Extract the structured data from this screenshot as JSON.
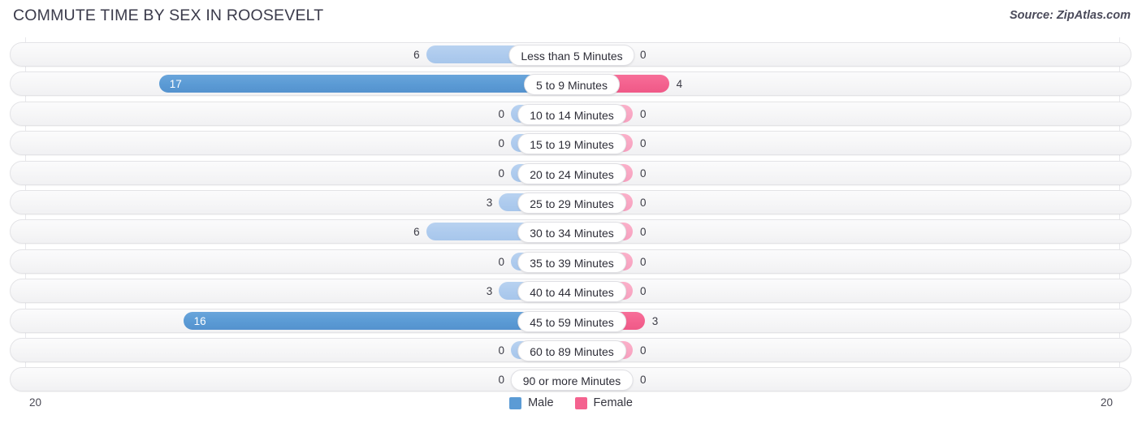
{
  "header": {
    "title": "COMMUTE TIME BY SEX IN ROOSEVELT",
    "source": "Source: ZipAtlas.com"
  },
  "axis": {
    "left_max_label": "20",
    "right_max_label": "20"
  },
  "legend": {
    "items": [
      {
        "label": "Male",
        "color": "#5b9bd5",
        "swatch_icon": "male-legend-swatch"
      },
      {
        "label": "Female",
        "color": "#f4628f",
        "swatch_icon": "female-legend-swatch"
      }
    ]
  },
  "colors": {
    "male": "#5b9bd5",
    "male_dim": "#aecbee",
    "female": "#f4628f",
    "female_dim": "#f9a8c4",
    "row_background": "#f6f6f7",
    "row_border": "#e3e3e6",
    "gridline": "#e8e8ec",
    "title": "#3a3a4a"
  },
  "chart_data": {
    "type": "bar",
    "subtype": "diverging-horizontal-bar",
    "title": "COMMUTE TIME BY SEX IN ROOSEVELT",
    "xlabel": "",
    "ylabel": "",
    "axis_max": 20,
    "xlim": [
      20,
      20
    ],
    "grid": true,
    "legend_position": "bottom-center",
    "categories": [
      "Less than 5 Minutes",
      "5 to 9 Minutes",
      "10 to 14 Minutes",
      "15 to 19 Minutes",
      "20 to 24 Minutes",
      "25 to 29 Minutes",
      "30 to 34 Minutes",
      "35 to 39 Minutes",
      "40 to 44 Minutes",
      "45 to 59 Minutes",
      "60 to 89 Minutes",
      "90 or more Minutes"
    ],
    "series": [
      {
        "name": "Male",
        "direction": "left",
        "values": [
          6,
          17,
          0,
          0,
          0,
          3,
          6,
          0,
          3,
          16,
          0,
          0
        ]
      },
      {
        "name": "Female",
        "direction": "right",
        "values": [
          0,
          4,
          0,
          0,
          0,
          0,
          0,
          0,
          0,
          3,
          0,
          0
        ]
      }
    ]
  },
  "rows": [
    {
      "label": "Less than 5 Minutes",
      "male": "6",
      "female": "0"
    },
    {
      "label": "5 to 9 Minutes",
      "male": "17",
      "female": "4"
    },
    {
      "label": "10 to 14 Minutes",
      "male": "0",
      "female": "0"
    },
    {
      "label": "15 to 19 Minutes",
      "male": "0",
      "female": "0"
    },
    {
      "label": "20 to 24 Minutes",
      "male": "0",
      "female": "0"
    },
    {
      "label": "25 to 29 Minutes",
      "male": "3",
      "female": "0"
    },
    {
      "label": "30 to 34 Minutes",
      "male": "6",
      "female": "0"
    },
    {
      "label": "35 to 39 Minutes",
      "male": "0",
      "female": "0"
    },
    {
      "label": "40 to 44 Minutes",
      "male": "3",
      "female": "0"
    },
    {
      "label": "45 to 59 Minutes",
      "male": "16",
      "female": "3"
    },
    {
      "label": "60 to 89 Minutes",
      "male": "0",
      "female": "0"
    },
    {
      "label": "90 or more Minutes",
      "male": "0",
      "female": "0"
    }
  ]
}
